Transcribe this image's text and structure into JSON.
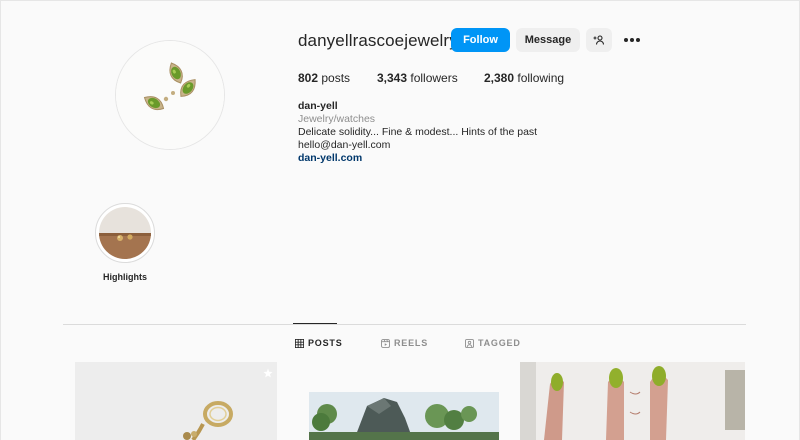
{
  "profile": {
    "username": "danyellrascoejewelry",
    "follow_label": "Follow",
    "message_label": "Message",
    "stats": {
      "posts_count": "802",
      "posts_label": "posts",
      "followers_count": "3,343",
      "followers_label": "followers",
      "following_count": "2,380",
      "following_label": "following"
    },
    "bio": {
      "name": "dan-yell",
      "category": "Jewelry/watches",
      "line1": "Delicate solidity... Fine & modest... Hints of the past",
      "email": "hello@dan-yell.com",
      "website": "dan-yell.com"
    }
  },
  "highlights": [
    {
      "label": "Highlights"
    }
  ],
  "tabs": [
    {
      "label": "POSTS",
      "icon": "grid-icon",
      "active": true
    },
    {
      "label": "REELS",
      "icon": "reels-icon",
      "active": false
    },
    {
      "label": "TAGGED",
      "icon": "tagged-icon",
      "active": false
    }
  ],
  "colors": {
    "follow_button": "#0095f6",
    "link": "#00376b",
    "gem_green": "#6a9a2a"
  }
}
